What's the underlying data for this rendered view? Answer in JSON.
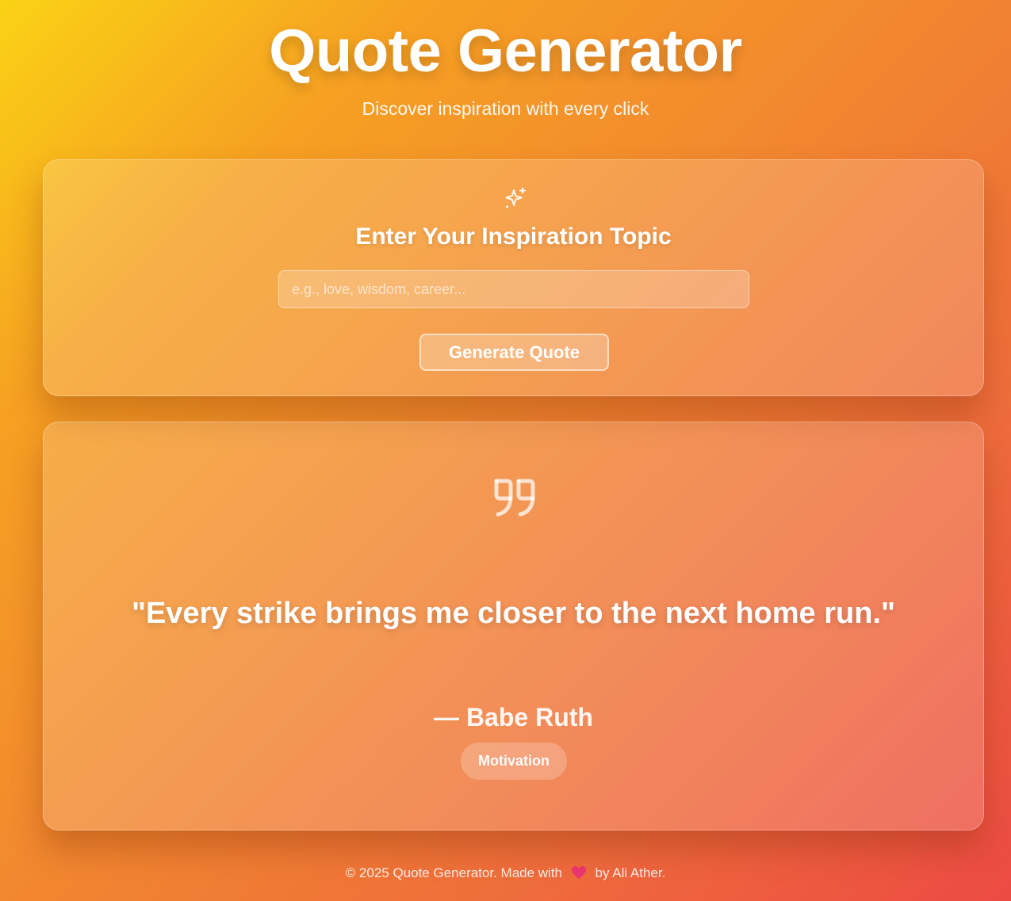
{
  "header": {
    "title": "Quote Generator",
    "subtitle": "Discover inspiration with every click"
  },
  "input_card": {
    "icon": "sparkle-icon",
    "heading": "Enter Your Inspiration Topic",
    "placeholder": "e.g., love, wisdom, career...",
    "value": "",
    "button_label": "Generate Quote"
  },
  "quote_card": {
    "icon": "quote-icon",
    "text": "\"Every strike brings me closer to the next home run.\"",
    "author": "— Babe Ruth",
    "category": "Motivation"
  },
  "footer": {
    "prefix": "© 2025 Quote Generator. Made with",
    "icon": "heart-icon",
    "suffix": "by Ali Ather."
  },
  "colors": {
    "gradient_start": "#fad215",
    "gradient_end": "#ec4a43",
    "heart": "#e8356e"
  }
}
